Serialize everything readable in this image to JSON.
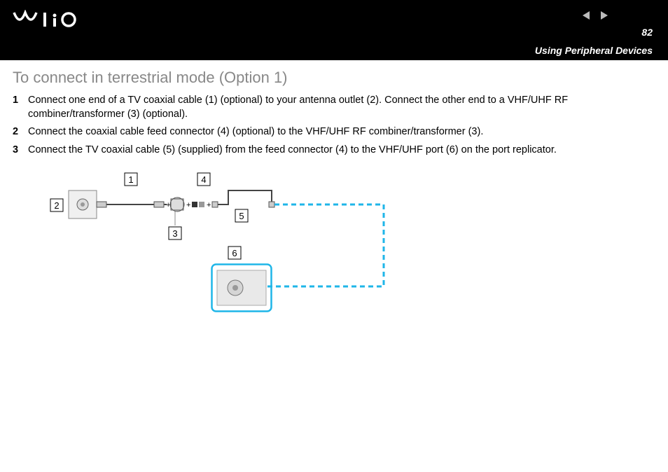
{
  "header": {
    "brand": "VAIO",
    "page_number": "82",
    "section_title": "Using Peripheral Devices"
  },
  "content": {
    "title": "To connect in terrestrial mode (Option 1)",
    "steps": [
      {
        "n": "1",
        "text": "Connect one end of a TV coaxial cable (1) (optional) to your antenna outlet (2). Connect the other end to a VHF/UHF RF combiner/transformer (3) (optional)."
      },
      {
        "n": "2",
        "text": "Connect the coaxial cable feed connector (4) (optional) to the VHF/UHF RF combiner/transformer (3)."
      },
      {
        "n": "3",
        "text": "Connect the TV coaxial cable (5) (supplied) from the feed connector (4) to the VHF/UHF port (6) on the port replicator."
      }
    ],
    "diagram_labels": {
      "l1": "1",
      "l2": "2",
      "l3": "3",
      "l4": "4",
      "l5": "5",
      "l6": "6"
    }
  }
}
